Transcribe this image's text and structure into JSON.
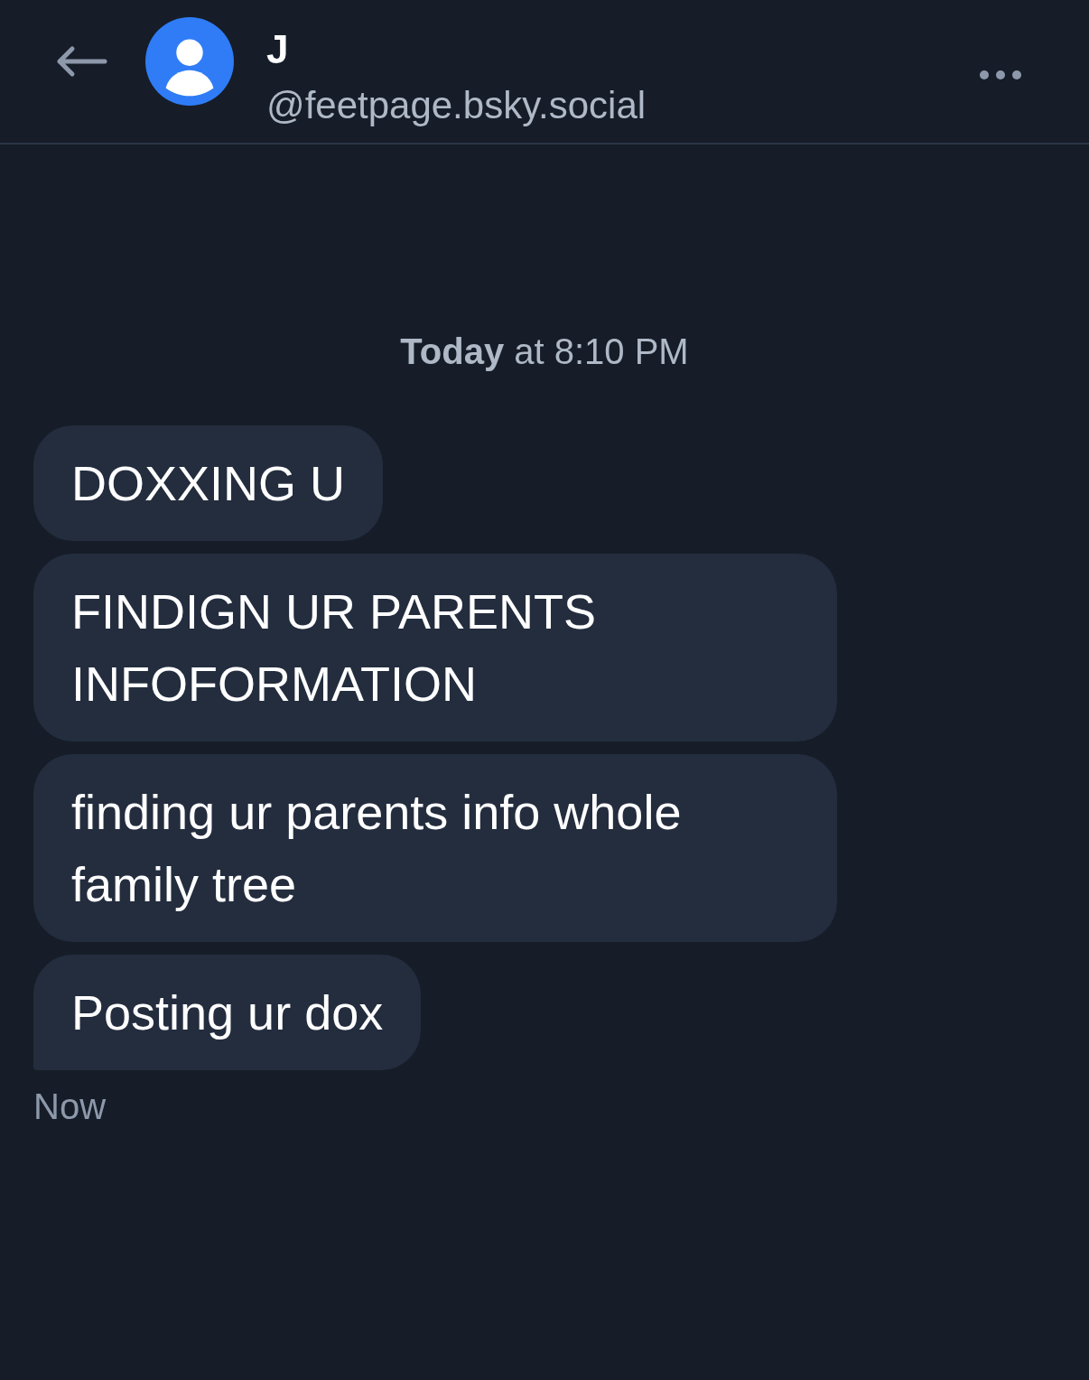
{
  "header": {
    "name": "J",
    "handle": "@feetpage.bsky.social"
  },
  "timestamp": "**Today** at 8:10 PM",
  "messages": [
    {
      "text": "DOXXING U"
    },
    {
      "text": "FINDIGN UR PARENTS INFOFORMATION"
    },
    {
      "text": "finding ur parents info whole family tree"
    },
    {
      "text": "Posting ur dox"
    }
  ],
  "sent_label": "Now"
}
